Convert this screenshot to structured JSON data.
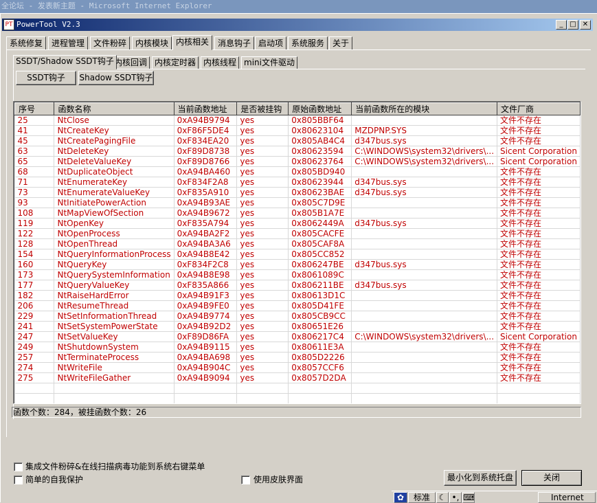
{
  "browser": {
    "title_prefix": "全论坛",
    "title_page": "发表新主题",
    "title_app": "Microsoft Internet Explorer",
    "separator": "-"
  },
  "window": {
    "title": "PowerTool V2.3",
    "icon_text": "PT",
    "min_glyph": "_",
    "max_glyph": "□",
    "close_glyph": "✕"
  },
  "main_tabs": [
    "系统修复",
    "进程管理",
    "文件粉碎",
    "内核模块",
    "内核相关",
    "消息钩子",
    "启动项",
    "系统服务",
    "关于"
  ],
  "sub_tabs": [
    "SSDT/Shadow SSDT钩子",
    "内核回调",
    "内核定时器",
    "内核线程",
    "mini文件驱动"
  ],
  "buttons": {
    "ssdt": "SSDT钩子",
    "shadow_ssdt": "Shadow SSDT钩子",
    "minimize_tray": "最小化到系统托盘",
    "close": "关闭"
  },
  "table": {
    "columns": [
      "序号",
      "函数名称",
      "当前函数地址",
      "是否被挂钩",
      "原始函数地址",
      "当前函数所在的模块",
      "文件厂商"
    ],
    "rows": [
      [
        "25",
        "NtClose",
        "0xA94B9794",
        "yes",
        "0x805BBF64",
        "",
        "文件不存在"
      ],
      [
        "41",
        "NtCreateKey",
        "0xF86F5DE4",
        "yes",
        "0x80623104",
        "MZDPNP.SYS",
        "文件不存在"
      ],
      [
        "45",
        "NtCreatePagingFile",
        "0xF834EA20",
        "yes",
        "0x805AB4C4",
        "d347bus.sys",
        "文件不存在"
      ],
      [
        "63",
        "NtDeleteKey",
        "0xF89D8738",
        "yes",
        "0x80623594",
        "C:\\WINDOWS\\system32\\drivers\\...",
        "Sicent Corporation"
      ],
      [
        "65",
        "NtDeleteValueKey",
        "0xF89D8766",
        "yes",
        "0x80623764",
        "C:\\WINDOWS\\system32\\drivers\\...",
        "Sicent Corporation"
      ],
      [
        "68",
        "NtDuplicateObject",
        "0xA94BA460",
        "yes",
        "0x805BD940",
        "",
        "文件不存在"
      ],
      [
        "71",
        "NtEnumerateKey",
        "0xF834F2A8",
        "yes",
        "0x80623944",
        "d347bus.sys",
        "文件不存在"
      ],
      [
        "73",
        "NtEnumerateValueKey",
        "0xF835A910",
        "yes",
        "0x80623BAE",
        "d347bus.sys",
        "文件不存在"
      ],
      [
        "93",
        "NtInitiatePowerAction",
        "0xA94B93AE",
        "yes",
        "0x805C7D9E",
        "",
        "文件不存在"
      ],
      [
        "108",
        "NtMapViewOfSection",
        "0xA94B9672",
        "yes",
        "0x805B1A7E",
        "",
        "文件不存在"
      ],
      [
        "119",
        "NtOpenKey",
        "0xF835A794",
        "yes",
        "0x8062449A",
        "d347bus.sys",
        "文件不存在"
      ],
      [
        "122",
        "NtOpenProcess",
        "0xA94BA2F2",
        "yes",
        "0x805CACFE",
        "",
        "文件不存在"
      ],
      [
        "128",
        "NtOpenThread",
        "0xA94BA3A6",
        "yes",
        "0x805CAF8A",
        "",
        "文件不存在"
      ],
      [
        "154",
        "NtQueryInformationProcess",
        "0xA94B8E42",
        "yes",
        "0x805CC852",
        "",
        "文件不存在"
      ],
      [
        "160",
        "NtQueryKey",
        "0xF834F2C8",
        "yes",
        "0x806247BE",
        "d347bus.sys",
        "文件不存在"
      ],
      [
        "173",
        "NtQuerySystemInformation",
        "0xA94B8E98",
        "yes",
        "0x8061089C",
        "",
        "文件不存在"
      ],
      [
        "177",
        "NtQueryValueKey",
        "0xF835A866",
        "yes",
        "0x806211BE",
        "d347bus.sys",
        "文件不存在"
      ],
      [
        "182",
        "NtRaiseHardError",
        "0xA94B91F3",
        "yes",
        "0x80613D1C",
        "",
        "文件不存在"
      ],
      [
        "206",
        "NtResumeThread",
        "0xA94B9FE0",
        "yes",
        "0x805D41FE",
        "",
        "文件不存在"
      ],
      [
        "229",
        "NtSetInformationThread",
        "0xA94B9774",
        "yes",
        "0x805CB9CC",
        "",
        "文件不存在"
      ],
      [
        "241",
        "NtSetSystemPowerState",
        "0xA94B92D2",
        "yes",
        "0x80651E26",
        "",
        "文件不存在"
      ],
      [
        "247",
        "NtSetValueKey",
        "0xF89D86FA",
        "yes",
        "0x806217C4",
        "C:\\WINDOWS\\system32\\drivers\\...",
        "Sicent Corporation"
      ],
      [
        "249",
        "NtShutdownSystem",
        "0xA94B9115",
        "yes",
        "0x80611E3A",
        "",
        "文件不存在"
      ],
      [
        "257",
        "NtTerminateProcess",
        "0xA94BA698",
        "yes",
        "0x805D2226",
        "",
        "文件不存在"
      ],
      [
        "274",
        "NtWriteFile",
        "0xA94B904C",
        "yes",
        "0x8057CCF6",
        "",
        "文件不存在"
      ],
      [
        "275",
        "NtWriteFileGather",
        "0xA94B9094",
        "yes",
        "0x8057D2DA",
        "",
        "文件不存在"
      ]
    ]
  },
  "status": "函数个数：284，被挂函数个数：26",
  "options": {
    "shell_menu": "集成文件粉碎&在线扫描病毒功能到系统右键菜单",
    "self_protect": "简单的自我保护",
    "skin": "使用皮肤界面"
  },
  "taskbar": {
    "ime_mode": "标准",
    "moon": "☾",
    "dots": "•,",
    "keyboard": "⌨",
    "zone": "Internet"
  }
}
